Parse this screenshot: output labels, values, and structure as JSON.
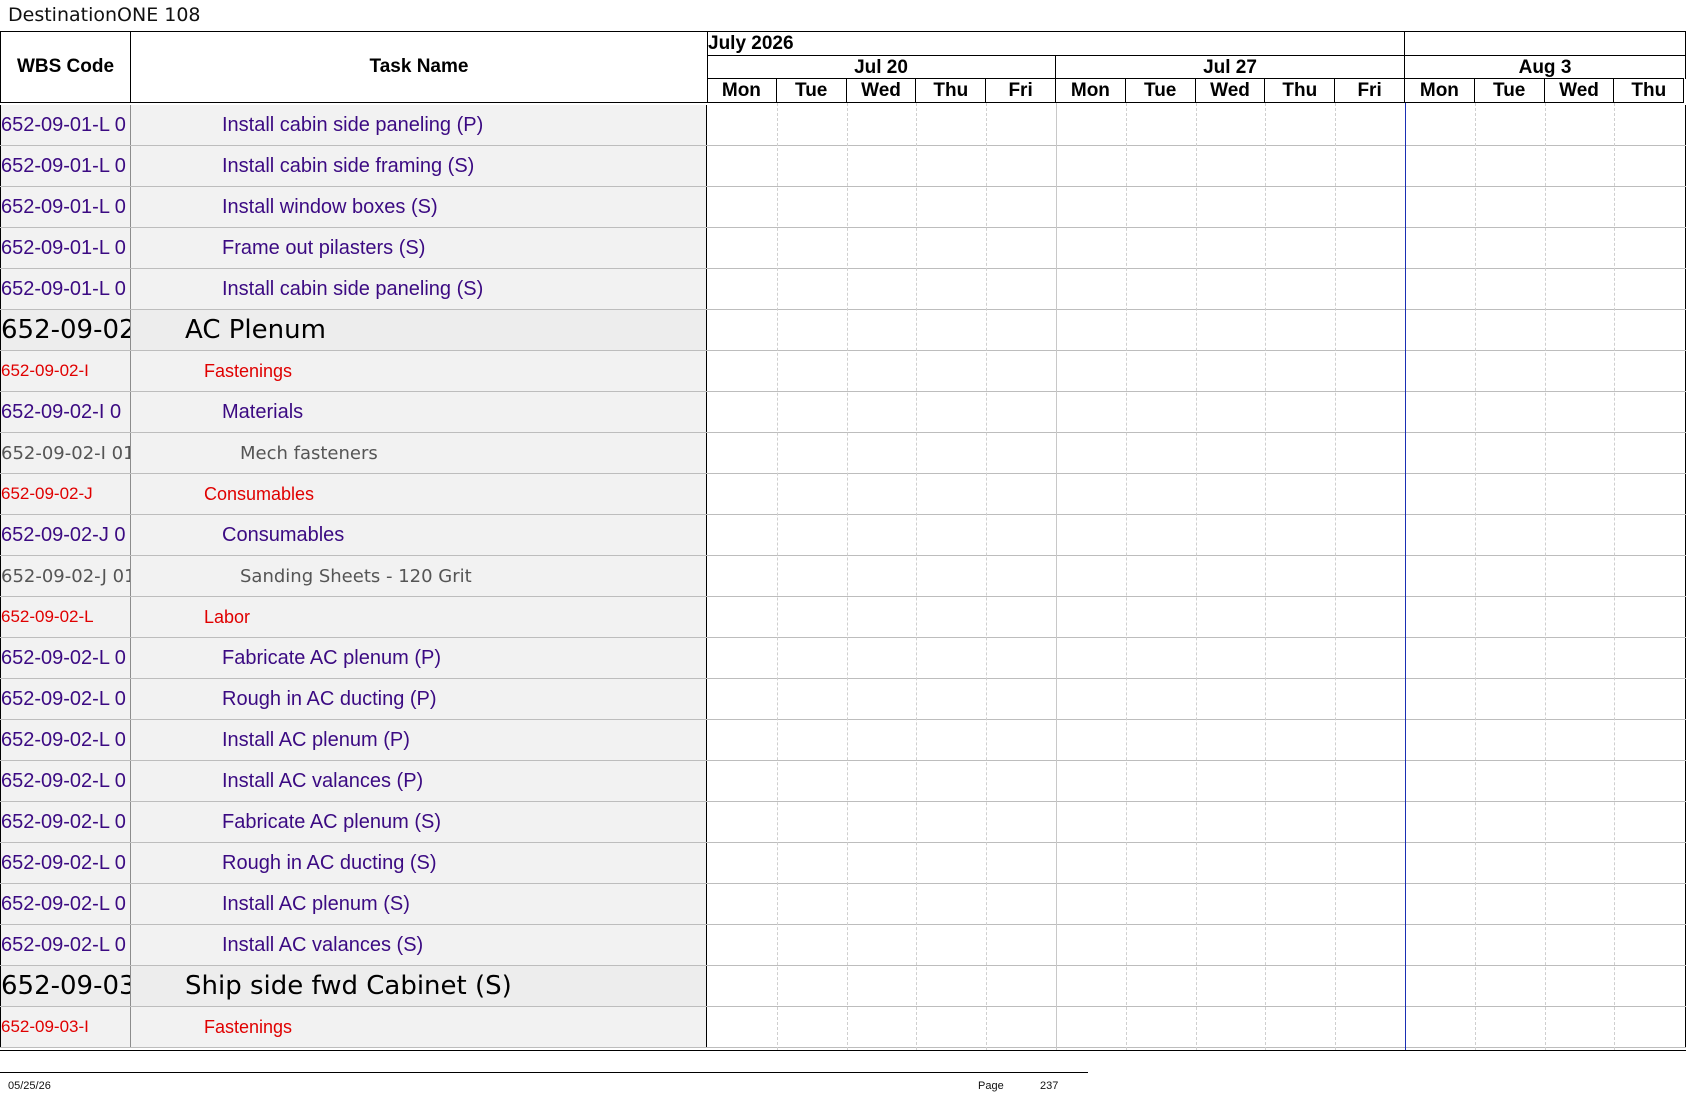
{
  "document_title": "DestinationONE 108",
  "columns": {
    "wbs_header": "WBS Code",
    "task_header": "Task Name"
  },
  "timeline": {
    "months": [
      "July 2026",
      ""
    ],
    "weeks": [
      "Jul 20",
      "Jul 27",
      "Aug 3"
    ],
    "days": [
      "Mon",
      "Tue",
      "Wed",
      "Thu",
      "Fri",
      "Mon",
      "Tue",
      "Wed",
      "Thu",
      "Fri",
      "Mon",
      "Tue",
      "Wed",
      "Thu"
    ]
  },
  "rows": [
    {
      "wbs": "652-09-01-L 0",
      "task": "Install cabin side paneling (P)",
      "level": "purple"
    },
    {
      "wbs": "652-09-01-L 0",
      "task": "Install cabin side framing (S)",
      "level": "purple"
    },
    {
      "wbs": "652-09-01-L 0",
      "task": "Install window boxes (S)",
      "level": "purple"
    },
    {
      "wbs": "652-09-01-L 0",
      "task": "Frame out pilasters (S)",
      "level": "purple"
    },
    {
      "wbs": "652-09-01-L 0",
      "task": "Install cabin side paneling (S)",
      "level": "purple"
    },
    {
      "wbs": "652-09-02",
      "task": "AC Plenum",
      "level": "group"
    },
    {
      "wbs": "652-09-02-I",
      "task": "Fastenings",
      "level": "red"
    },
    {
      "wbs": "652-09-02-I 0",
      "task": "Materials",
      "level": "purple"
    },
    {
      "wbs": "652-09-02-I 01-",
      "task": "Mech fasteners",
      "level": "gray"
    },
    {
      "wbs": "652-09-02-J",
      "task": "Consumables",
      "level": "red"
    },
    {
      "wbs": "652-09-02-J 0",
      "task": "Consumables",
      "level": "purple"
    },
    {
      "wbs": "652-09-02-J 01",
      "task": "Sanding Sheets - 120 Grit",
      "level": "gray"
    },
    {
      "wbs": "652-09-02-L",
      "task": "Labor",
      "level": "red"
    },
    {
      "wbs": "652-09-02-L 0",
      "task": "Fabricate AC plenum (P)",
      "level": "purple"
    },
    {
      "wbs": "652-09-02-L 0",
      "task": "Rough in AC ducting (P)",
      "level": "purple"
    },
    {
      "wbs": "652-09-02-L 0",
      "task": "Install AC plenum (P)",
      "level": "purple"
    },
    {
      "wbs": "652-09-02-L 0",
      "task": "Install AC valances (P)",
      "level": "purple"
    },
    {
      "wbs": "652-09-02-L 0",
      "task": "Fabricate AC plenum (S)",
      "level": "purple"
    },
    {
      "wbs": "652-09-02-L 0",
      "task": "Rough in AC ducting (S)",
      "level": "purple"
    },
    {
      "wbs": "652-09-02-L 0",
      "task": "Install AC plenum (S)",
      "level": "purple"
    },
    {
      "wbs": "652-09-02-L 0",
      "task": "Install AC valances (S)",
      "level": "purple"
    },
    {
      "wbs": "652-09-03",
      "task": "Ship side fwd Cabinet (S)",
      "level": "group"
    },
    {
      "wbs": "652-09-03-I",
      "task": "Fastenings",
      "level": "red"
    }
  ],
  "footer": {
    "date": "05/25/26",
    "page_label": "Page",
    "page_number": "237"
  }
}
